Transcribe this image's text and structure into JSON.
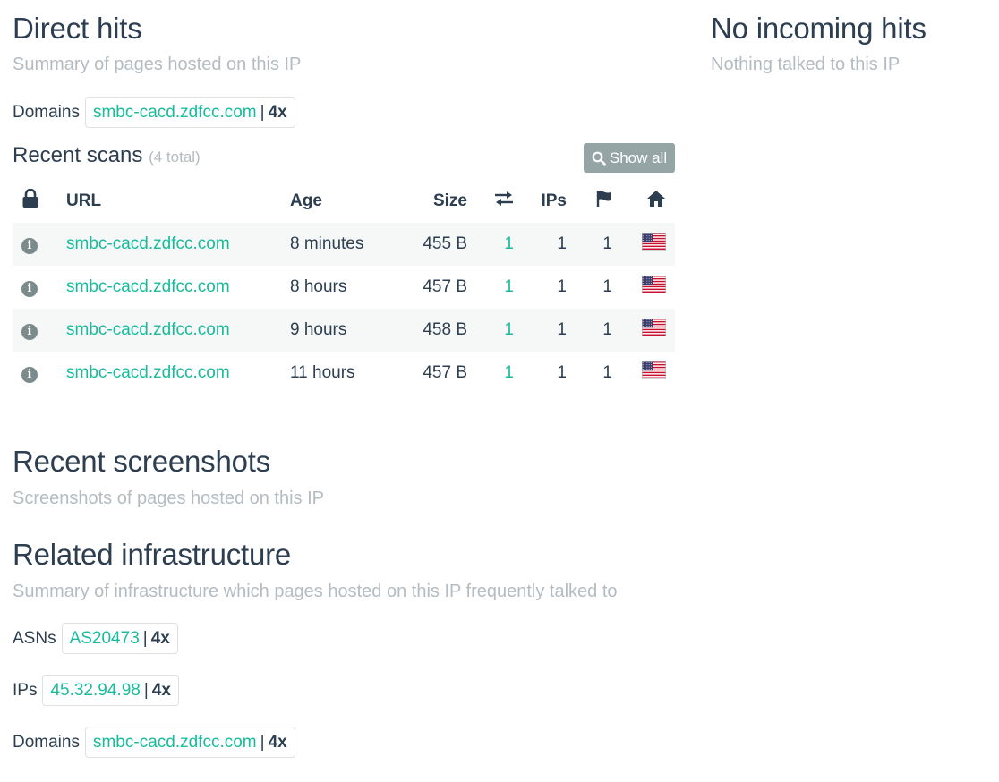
{
  "direct_hits": {
    "title": "Direct hits",
    "subtitle": "Summary of pages hosted on this IP",
    "domains_label": "Domains",
    "domain": {
      "name": "smbc-cacd.zdfcc.com",
      "count": "4x"
    }
  },
  "no_incoming": {
    "title": "No incoming hits",
    "subtitle": "Nothing talked to this IP"
  },
  "recent_scans": {
    "title": "Recent scans",
    "total": "(4 total)",
    "show_all": "Show all",
    "columns": {
      "url": "URL",
      "age": "Age",
      "size": "Size",
      "ips": "IPs"
    },
    "rows": [
      {
        "url": "smbc-cacd.zdfcc.com",
        "age": "8 minutes",
        "size": "455 B",
        "redirects": "1",
        "ips": "1",
        "flags": "1",
        "country": "us-flag"
      },
      {
        "url": "smbc-cacd.zdfcc.com",
        "age": "8 hours",
        "size": "457 B",
        "redirects": "1",
        "ips": "1",
        "flags": "1",
        "country": "us-flag"
      },
      {
        "url": "smbc-cacd.zdfcc.com",
        "age": "9 hours",
        "size": "458 B",
        "redirects": "1",
        "ips": "1",
        "flags": "1",
        "country": "us-flag"
      },
      {
        "url": "smbc-cacd.zdfcc.com",
        "age": "11 hours",
        "size": "457 B",
        "redirects": "1",
        "ips": "1",
        "flags": "1",
        "country": "us-flag"
      }
    ]
  },
  "screenshots": {
    "title": "Recent screenshots",
    "subtitle": "Screenshots of pages hosted on this IP"
  },
  "infrastructure": {
    "title": "Related infrastructure",
    "subtitle": "Summary of infrastructure which pages hosted on this IP frequently talked to",
    "asns_label": "ASNs",
    "asn": {
      "name": "AS20473",
      "count": "4x"
    },
    "ips_label": "IPs",
    "ip": {
      "name": "45.32.94.98",
      "count": "4x"
    },
    "domains_label": "Domains",
    "domain": {
      "name": "smbc-cacd.zdfcc.com",
      "count": "4x"
    }
  },
  "colors": {
    "accent": "#18bc9c",
    "text": "#2c3e50",
    "muted": "#b4bcc2",
    "button": "#95a5a6"
  }
}
